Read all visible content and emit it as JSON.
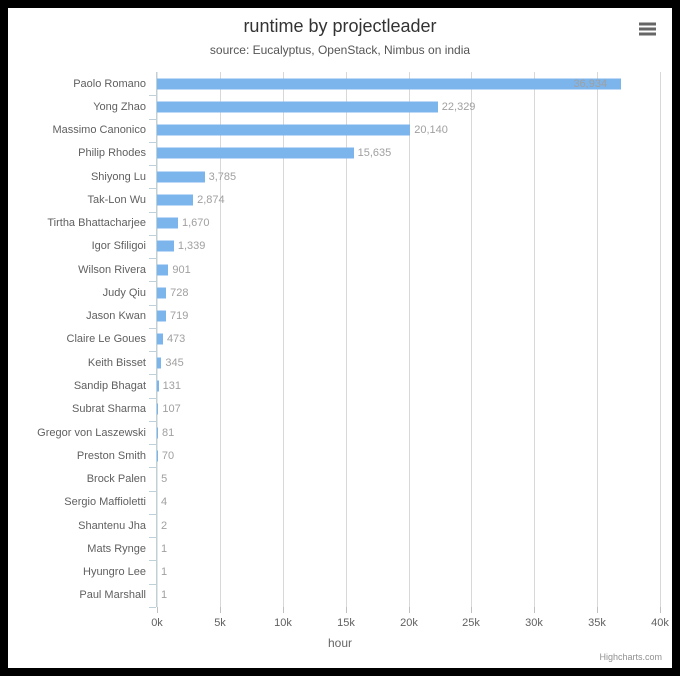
{
  "chart": {
    "title": "runtime by projectleader",
    "subtitle": "source: Eucalyptus, OpenStack, Nimbus on india",
    "credits": "Highcharts.com",
    "context_menu_icon": "hamburger-menu-icon",
    "bar_color": "#7cb5ec",
    "gridline_color": "#d8d8d8",
    "axis_line_color": "#c0d0d8",
    "label_color": "#606060",
    "data_label_color": "#a0a0a0"
  },
  "chart_data": {
    "type": "bar",
    "title": "runtime by projectleader",
    "subtitle": "source: Eucalyptus, OpenStack, Nimbus on india",
    "xlabel": "hour",
    "ylabel": "",
    "orientation": "horizontal",
    "grid": true,
    "legend": false,
    "xlim": [
      0,
      40000
    ],
    "xticks": [
      0,
      5000,
      10000,
      15000,
      20000,
      25000,
      30000,
      35000,
      40000
    ],
    "xtick_labels": [
      "0k",
      "5k",
      "10k",
      "15k",
      "20k",
      "25k",
      "30k",
      "35k",
      "40k"
    ],
    "categories": [
      "Paolo Romano",
      "Yong Zhao",
      "Massimo Canonico",
      "Philip Rhodes",
      "Shiyong Lu",
      "Tak-Lon Wu",
      "Tirtha Bhattacharjee",
      "Igor Sfiligoi",
      "Wilson Rivera",
      "Judy Qiu",
      "Jason Kwan",
      "Claire Le Goues",
      "Keith Bisset",
      "Sandip Bhagat",
      "Subrat Sharma",
      "Gregor von Laszewski",
      "Preston Smith",
      "Brock Palen",
      "Sergio Maffioletti",
      "Shantenu Jha",
      "Mats Rynge",
      "Hyungro Lee",
      "Paul Marshall"
    ],
    "values": [
      36934,
      22329,
      20140,
      15635,
      3785,
      2874,
      1670,
      1339,
      901,
      728,
      719,
      473,
      345,
      131,
      107,
      81,
      70,
      5,
      4,
      2,
      1,
      1,
      1
    ],
    "data_labels": [
      "36,934",
      "22,329",
      "20,140",
      "15,635",
      "3,785",
      "2,874",
      "1,670",
      "1,339",
      "901",
      "728",
      "719",
      "473",
      "345",
      "131",
      "107",
      "81",
      "70",
      "5",
      "4",
      "2",
      "1",
      "1",
      "1"
    ]
  }
}
